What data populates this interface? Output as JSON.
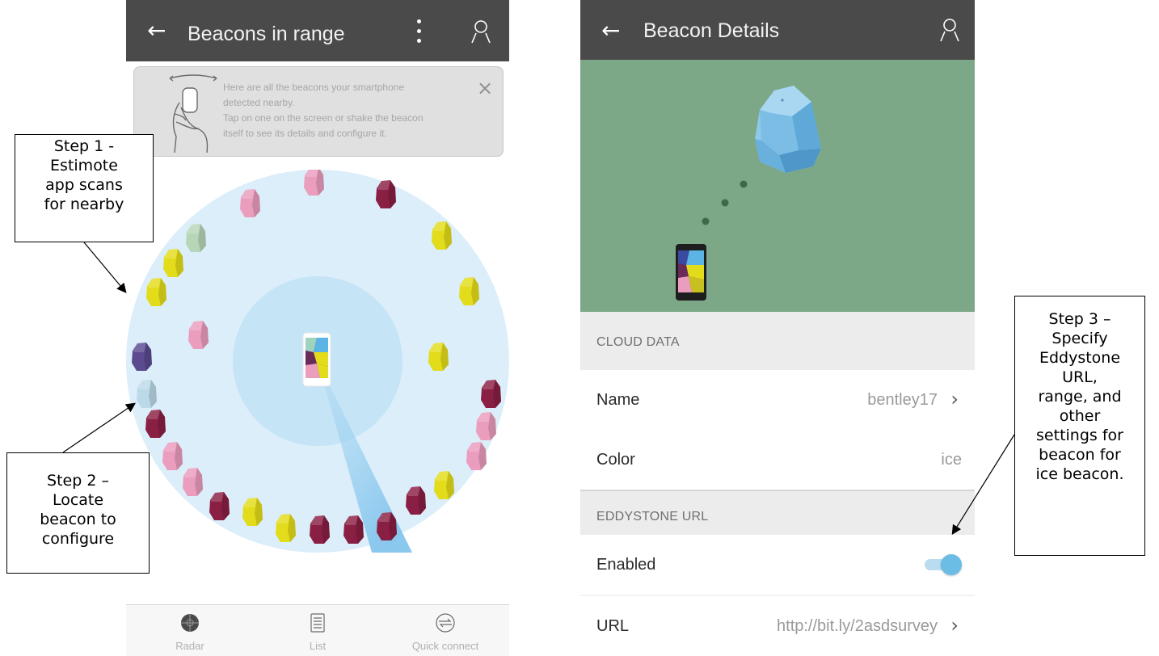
{
  "left_screen": {
    "title": "Beacons in range",
    "tip": {
      "lines": [
        "Here are all the beacons your smartphone",
        "detected nearby.",
        "Tap on one on the screen or shake the beacon",
        "itself to see its details and configure it."
      ],
      "close_symbol": "×"
    },
    "nav": [
      {
        "label": "Radar",
        "icon": "radar-icon"
      },
      {
        "label": "List",
        "icon": "list-icon"
      },
      {
        "label": "Quick connect",
        "icon": "quick-connect-icon"
      }
    ]
  },
  "right_screen": {
    "title": "Beacon Details",
    "cloud_section": "CLOUD DATA",
    "name": {
      "label": "Name",
      "value": "bentley17"
    },
    "color": {
      "label": "Color",
      "value": "ice"
    },
    "eddystone_section": "EDDYSTONE URL",
    "enabled": {
      "label": "Enabled",
      "on": true
    },
    "url": {
      "label": "URL",
      "value": "http://bit.ly/2asdsurvey"
    }
  },
  "callouts": {
    "step1": [
      "Step 1 -",
      "Estimote",
      "app scans",
      "for nearby"
    ],
    "step2": [
      "Step 2 –",
      "Locate",
      "beacon to",
      "configure"
    ],
    "step3": [
      "Step 3 –",
      "Specify",
      "Eddystone",
      "URL,",
      "range, and",
      "other",
      "settings for",
      "beacon for",
      "ice beacon."
    ]
  },
  "colors": {
    "appbar": "#4a4a4a",
    "hero_green": "#7ca887",
    "beacon_pink": "#eb9dbe",
    "beacon_yellow": "#e3dc1a",
    "beacon_maroon": "#8a1f44",
    "beacon_purple": "#5b4a90",
    "beacon_ice": "#bcd9e8",
    "beacon_mint": "#b7d6b8",
    "radar_outer": "#dbeefa",
    "radar_inner": "#c5e4f6",
    "toggle_on": "#6bbde5"
  }
}
